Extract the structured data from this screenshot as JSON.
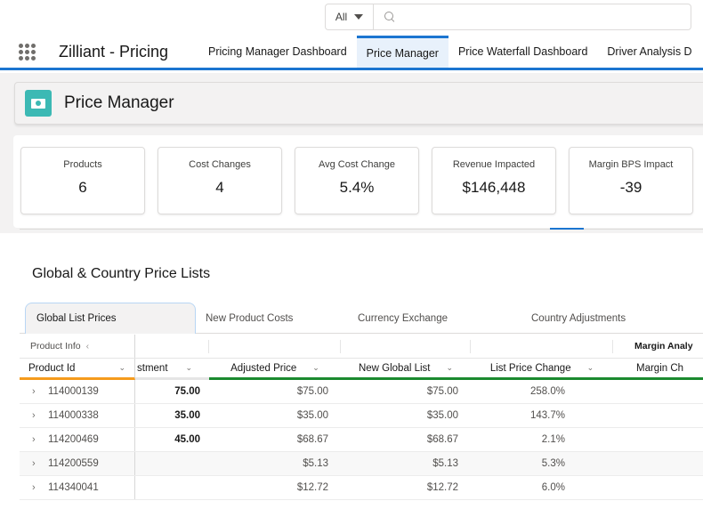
{
  "search": {
    "scope": "All",
    "placeholder": ""
  },
  "nav": {
    "app_name": "Zilliant - Pricing",
    "tabs": [
      {
        "label": "Pricing Manager Dashboard",
        "active": false
      },
      {
        "label": "Price Manager",
        "active": true
      },
      {
        "label": "Price Waterfall Dashboard",
        "active": false
      },
      {
        "label": "Driver Analysis D",
        "active": false
      }
    ]
  },
  "header": {
    "title": "Price Manager",
    "icon": "money-icon",
    "icon_color": "#3cb9b4"
  },
  "kpis": [
    {
      "label": "Products",
      "value": "6"
    },
    {
      "label": "Cost Changes",
      "value": "4"
    },
    {
      "label": "Avg Cost Change",
      "value": "5.4%"
    },
    {
      "label": "Revenue Impacted",
      "value": "$146,448"
    },
    {
      "label": "Margin BPS Impact",
      "value": "-39"
    }
  ],
  "section": {
    "title": "Global & Country Price Lists"
  },
  "tabs": [
    {
      "label": "Global List Prices",
      "active": true
    },
    {
      "label": "New Product Costs",
      "active": false
    },
    {
      "label": "Currency Exchange",
      "active": false
    },
    {
      "label": "Country Adjustments",
      "active": false
    }
  ],
  "table": {
    "groups": {
      "product_info": "Product Info",
      "margin_analysis": "Margin Analy"
    },
    "columns": [
      "Product Id",
      "stment",
      "Adjusted Price",
      "New Global List",
      "List Price Change",
      "Margin Ch"
    ],
    "rows": [
      {
        "product_id": "114000139",
        "adjustment": "75.00",
        "adjusted_price": "$75.00",
        "new_global_list": "$75.00",
        "list_price_change": "258.0%",
        "margin_change": ""
      },
      {
        "product_id": "114000338",
        "adjustment": "35.00",
        "adjusted_price": "$35.00",
        "new_global_list": "$35.00",
        "list_price_change": "143.7%",
        "margin_change": ""
      },
      {
        "product_id": "114200469",
        "adjustment": "45.00",
        "adjusted_price": "$68.67",
        "new_global_list": "$68.67",
        "list_price_change": "2.1%",
        "margin_change": ""
      },
      {
        "product_id": "114200559",
        "adjustment": "",
        "adjusted_price": "$5.13",
        "new_global_list": "$5.13",
        "list_price_change": "5.3%",
        "margin_change": ""
      },
      {
        "product_id": "114340041",
        "adjustment": "",
        "adjusted_price": "$12.72",
        "new_global_list": "$12.72",
        "list_price_change": "6.0%",
        "margin_change": ""
      }
    ]
  },
  "colors": {
    "brand_blue": "#1b75d0",
    "pinned_column_accent": "#f59b1d",
    "editable_column_accent": "#1b8a2f"
  }
}
